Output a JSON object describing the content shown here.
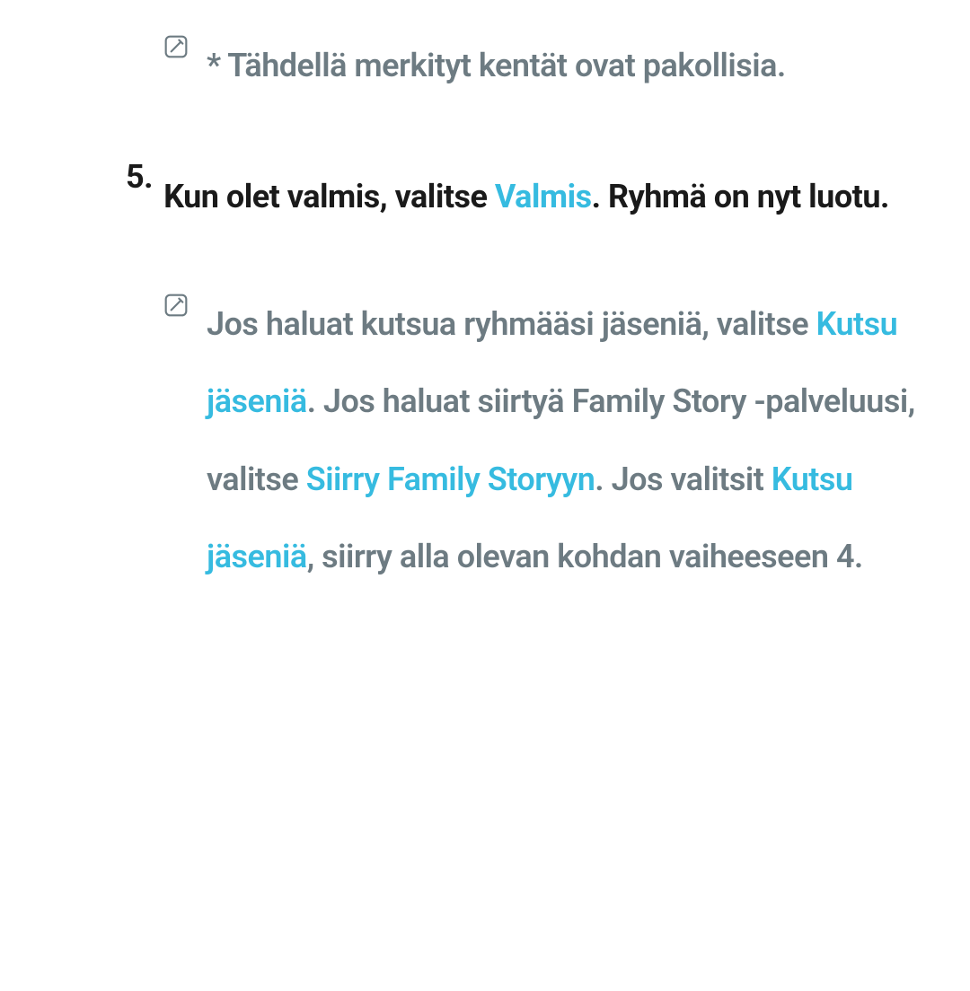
{
  "note1": {
    "text": "* Tähdellä merkityt kentät ovat pakollisia."
  },
  "step5": {
    "number": "5.",
    "part1": "Kun olet valmis, valitse ",
    "hl1": "Valmis",
    "part2": ". Ryhmä on nyt luotu."
  },
  "note2": {
    "part1": "Jos haluat kutsua ryhmääsi jäseniä, valitse ",
    "hl1": "Kutsu jäseniä",
    "part2": ". Jos haluat siirtyä Family Story -palveluusi, valitse ",
    "hl2": "Siirry Family Storyyn",
    "part3": ". Jos valitsit ",
    "hl3": "Kutsu jäseniä",
    "part4": ", siirry alla olevan kohdan vaiheeseen 4."
  }
}
